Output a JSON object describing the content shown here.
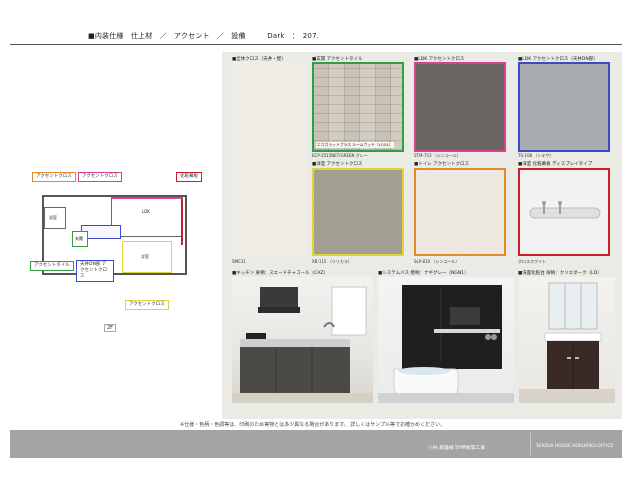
{
  "header": {
    "title": "■内装仕様　仕上材　／　アクセント　／　設備　　　Dark　：　207."
  },
  "swatches": [
    {
      "label": "■全体クロス（天井・壁）",
      "code": "SMC31"
    },
    {
      "label": "■玄関 アクセントタイル",
      "code": "ECP-2515NET/GREEN グレー",
      "overlay": "エコカラットプラス ルームウッド（LOGL）"
    },
    {
      "label": "■LDK アクセントクロス",
      "code": "STM-753 （シンコール）"
    },
    {
      "label": "■LDK アクセントクロス（天井DN部）",
      "code": "TS-108 （トキワ）"
    },
    {
      "label": "■洋室 アクセントクロス",
      "code": "XB-115 （リリカラ）"
    },
    {
      "label": "■トイレ アクセントクロス",
      "code": "SLP-810 （シンコール）"
    },
    {
      "label": "■洋室 化粧幕板 ディスプレイタイプ",
      "code": "グロスホワイト"
    }
  ],
  "photos": [
    {
      "label": "■キッチン 扉柄：スエードチャコール（CAZ）"
    },
    {
      "label": "■システムバス 壁柄：ナギグレー（NGN1）"
    },
    {
      "label": "■洗面化粧台 扉柄：クリエダーク（LD）"
    }
  ],
  "floorplan": {
    "tags": [
      {
        "text": "アクセントクロス",
        "color": "orange"
      },
      {
        "text": "アクセントクロス",
        "color": "pink"
      },
      {
        "text": "化粧幕板",
        "color": "red"
      },
      {
        "text": "アクセントタイル",
        "color": "green"
      },
      {
        "text": "天井DN部 アクセントクロス",
        "color": "blue"
      },
      {
        "text": "アクセントクロス",
        "color": "yellow"
      }
    ],
    "rooms": {
      "ldk": "LDK",
      "bedroom": "洋室",
      "bath": "浴室",
      "entrance": "玄関"
    },
    "floor_label": "2F"
  },
  "footer": {
    "note": "※仕様・色柄・色調等は、印刷のため実物とは多少異なる場合があります。 詳しくはサンプル等でお確かめください。",
    "company_left": "小林 美雄様 SHM新築工事",
    "company_right": "SEKISUI HOUSE HOKURIKU OFFICE"
  }
}
